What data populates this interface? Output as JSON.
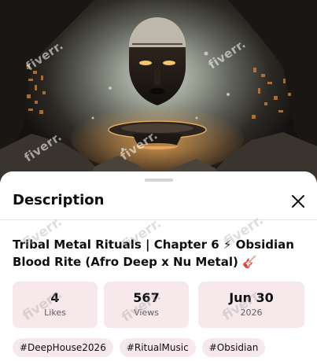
{
  "video": {
    "watermark": "fiverr.",
    "icons": {
      "mask": "tribal-mask-icon",
      "disc": "floating-disc-icon"
    }
  },
  "sheet": {
    "title": "Description",
    "close_icon": "close-icon",
    "watermark": "fiverr."
  },
  "video_title": "Tribal Metal Rituals | Chapter 6 ⚡ Obsidian Blood Rite (Afro Deep x Nu Metal) 🎸",
  "stats": {
    "likes": {
      "value": "4",
      "label": "Likes"
    },
    "views": {
      "value": "567",
      "label": "Views"
    },
    "date": {
      "value": "Jun 30",
      "label": "2026"
    }
  },
  "hashtags": [
    "#DeepHouse2026",
    "#RitualMusic",
    "#Obsidian"
  ],
  "colors": {
    "stat_bg": "#f7e8ec",
    "text": "#0f0f0f",
    "muted": "#606060"
  }
}
